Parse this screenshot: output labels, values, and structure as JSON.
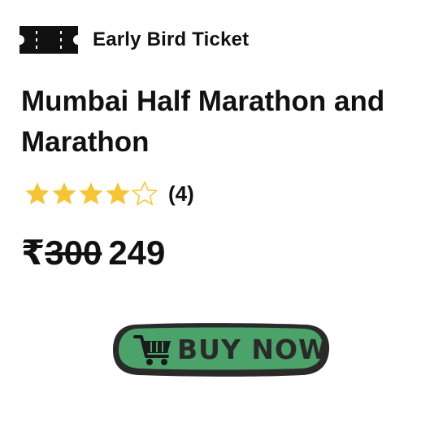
{
  "ticket": {
    "icon": "ticket-icon",
    "label": "Early Bird Ticket"
  },
  "event": {
    "title": "Mumbai Half Marathon and Marathon"
  },
  "rating": {
    "value": 4,
    "max": 5,
    "count_text": "(4)",
    "star_color": "#f7c531"
  },
  "price": {
    "currency": "₹",
    "original": "300",
    "current": "249"
  },
  "buy_button": {
    "label": "BUY NOW",
    "icon": "cart-icon",
    "fill_color": "#4ba36a",
    "border_color": "#2a2a2a"
  }
}
